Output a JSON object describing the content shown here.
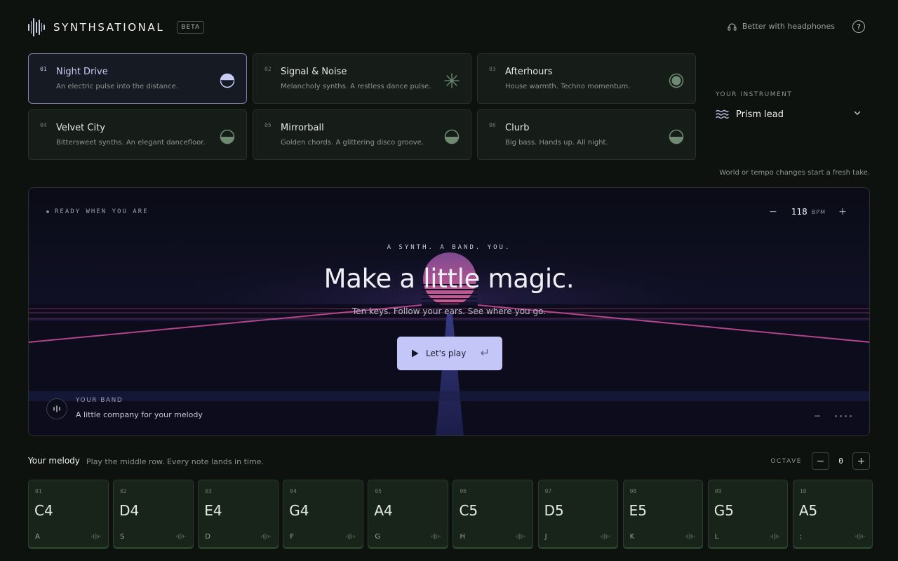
{
  "app": {
    "name": "SYNTHSATIONAL",
    "badge": "BETA",
    "headphones_note": "Better with headphones",
    "help_glyph": "?"
  },
  "worlds": [
    {
      "num": "01",
      "name": "Night Drive",
      "desc": "An electric pulse into the distance.",
      "icon": "half-circle-icon",
      "active": true
    },
    {
      "num": "02",
      "name": "Signal & Noise",
      "desc": "Melancholy synths. A restless dance pulse.",
      "icon": "starburst-icon",
      "active": false
    },
    {
      "num": "03",
      "name": "Afterhours",
      "desc": "House warmth. Techno momentum.",
      "icon": "target-circle-icon",
      "active": false
    },
    {
      "num": "04",
      "name": "Velvet City",
      "desc": "Bittersweet synths. An elegant dancefloor.",
      "icon": "half-circle-icon",
      "active": false
    },
    {
      "num": "05",
      "name": "Mirrorball",
      "desc": "Golden chords. A glittering disco groove.",
      "icon": "half-circle-icon",
      "active": false
    },
    {
      "num": "06",
      "name": "Clurb",
      "desc": "Big bass. Hands up. All night.",
      "icon": "half-circle-icon",
      "active": false
    }
  ],
  "instrument": {
    "label": "YOUR INSTRUMENT",
    "selected": "Prism lead",
    "icon": "wave-icon",
    "note": "World or tempo changes start a fresh take."
  },
  "stage": {
    "status": "READY WHEN YOU ARE",
    "tempo": {
      "value": "118",
      "unit": "BPM",
      "minus": "−",
      "plus": "+"
    },
    "kicker": "A SYNTH. A BAND. YOU.",
    "headline": "Make a little magic.",
    "subline": "Ten keys. Follow your ears. See where you go.",
    "play_label": "Let's play",
    "band": {
      "label": "YOUR BAND",
      "desc": "A little company for your melody",
      "minus": "−"
    }
  },
  "melody": {
    "title": "Your melody",
    "subtitle": "Play the middle row. Every note lands in time.",
    "octave_label": "OCTAVE",
    "octave_value": "0",
    "octave_minus": "−",
    "octave_plus": "+",
    "keys": [
      {
        "num": "01",
        "note": "C4",
        "shortcut": "A"
      },
      {
        "num": "02",
        "note": "D4",
        "shortcut": "S"
      },
      {
        "num": "03",
        "note": "E4",
        "shortcut": "D"
      },
      {
        "num": "04",
        "note": "G4",
        "shortcut": "F"
      },
      {
        "num": "05",
        "note": "A4",
        "shortcut": "G"
      },
      {
        "num": "06",
        "note": "C5",
        "shortcut": "H"
      },
      {
        "num": "07",
        "note": "D5",
        "shortcut": "J"
      },
      {
        "num": "08",
        "note": "E5",
        "shortcut": "K"
      },
      {
        "num": "09",
        "note": "G5",
        "shortcut": "L"
      },
      {
        "num": "10",
        "note": "A5",
        "shortcut": ";"
      }
    ]
  },
  "colors": {
    "background": "#0e120f",
    "accent": "#c4c6f7",
    "sun": "#d05a9a",
    "grid_pink": "#d04f9c",
    "key_green": "#182319"
  }
}
